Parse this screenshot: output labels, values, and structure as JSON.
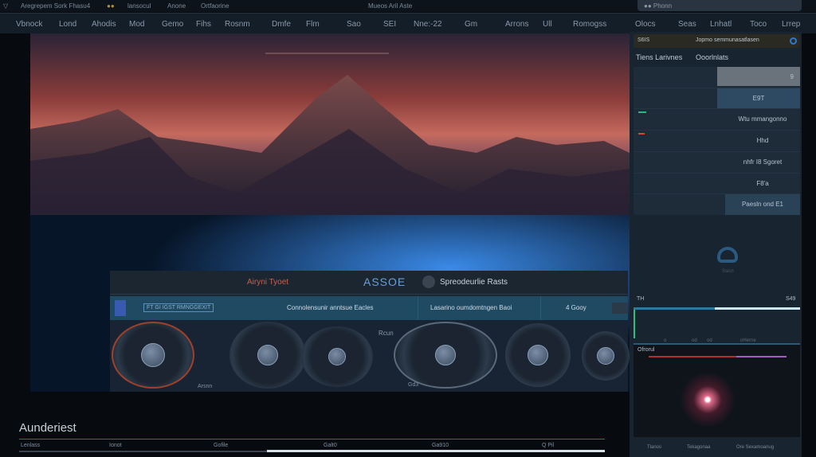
{
  "titlebar": {
    "app_title": "Aregrepem Sork Fhasu4",
    "items": [
      "lansocul",
      "Anone",
      "Ortfaorine"
    ],
    "center_text": "Mueos Aril Aste",
    "search_placeholder": "Phonn"
  },
  "menubar": {
    "items": [
      "Vbnock",
      "Lond",
      "Ahodis",
      "Mod",
      "Gemo",
      "Fihs",
      "Rosnm",
      "Dmfe",
      "Flm",
      "Sao",
      "SEI",
      "Nne:-22",
      "Gm",
      "Arrons",
      "Ull",
      "Romogss",
      "Olocs",
      "Seas",
      "Lnhatl",
      "Toco",
      "Lrrep"
    ]
  },
  "plugin": {
    "left_title": "Airyni Tyoet",
    "logo_text": "ASSOE",
    "right_title": "Spreodeurlie Rasts",
    "bar_tag": "FT GI IGST RMNGGEXIT",
    "bar_center": "Connolensunir anntsue Eacles",
    "bar_right": "Lasarino oumdomtngen Baoi",
    "bar_small": "4 Gooy",
    "knob_center_label": "Rcun",
    "knob_labels": [
      "Arsnn",
      "Gd3"
    ]
  },
  "right_panel": {
    "header_left": "S6IS",
    "header_right": "Jopmo semmunasatlasen",
    "tabs": [
      "Tiens Larivnes",
      "Ooorlnlats"
    ],
    "rows": [
      "9",
      "E9T",
      "Wtu mmangonno",
      "Hhd",
      "nhfr I8 Sgoret",
      "F8'a",
      "Paesln ond E1"
    ],
    "avatar_label": "Ssicn",
    "timeline_left": "TH",
    "timeline_right": "S49",
    "timeline_ticks": [
      "o",
      "od",
      "od",
      "oHerne"
    ],
    "graph_title": "Ofrorul",
    "footer": [
      "Tlanos",
      "Tekagonaa",
      "Ore Sexamoanug"
    ]
  },
  "bottom": {
    "title": "Aunderiest",
    "labels": [
      "Lenlass",
      "Ionot",
      "Gofile",
      "Galt0",
      "Ga910",
      "Q Pil"
    ],
    "scroll_position": 0.42
  },
  "colors": {
    "accent": "#2a8fb8",
    "alert": "#c0453a",
    "highlight": "#e06a8a"
  }
}
